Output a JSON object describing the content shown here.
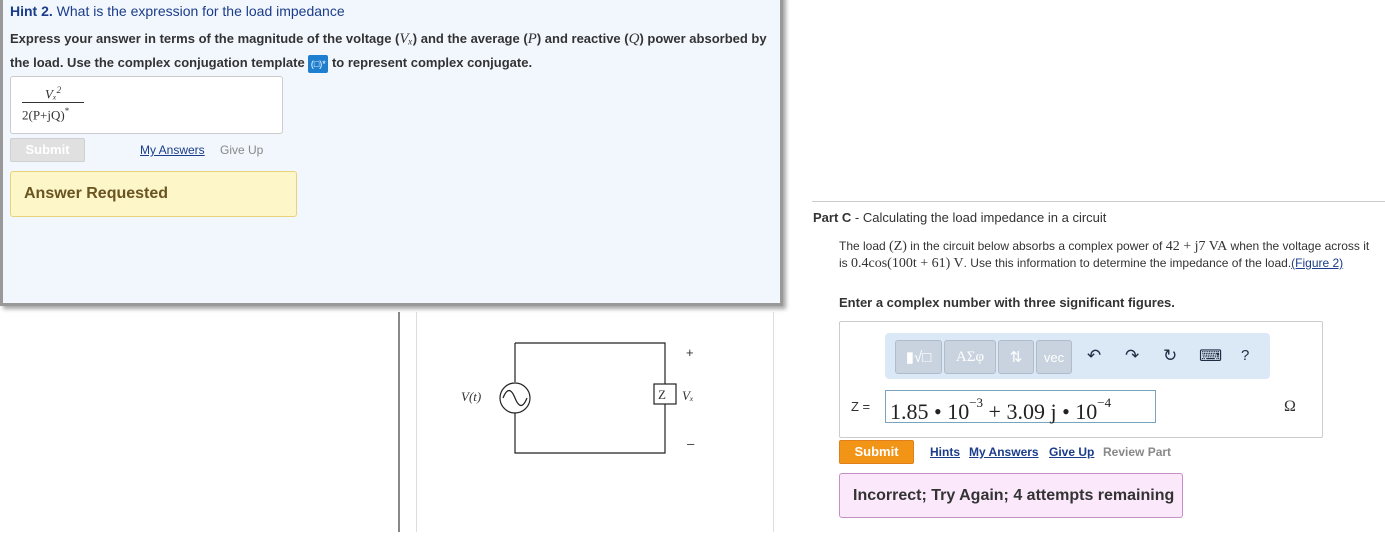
{
  "hint": {
    "number": "Hint 2.",
    "title": "What is the expression for the load impedance",
    "instr_1": "Express your answer in terms of the magnitude of the voltage (",
    "sym_vx": "Vₓ",
    "instr_2": ") and the average (",
    "sym_p": "P",
    "instr_3": ") and reactive (",
    "sym_q": "Q",
    "instr_4": ") power absorbed by the load. Use the complex conjugation template",
    "conj_icon": "(□)*",
    "instr_5": "to represent complex conjugate.",
    "answer_num": "Vₓ",
    "answer_num_exp": "2",
    "answer_den": "2(P+jQ)",
    "answer_den_exp": "*",
    "submit": "Submit",
    "my_answers": "My Answers",
    "give_up": "Give Up",
    "status": "Answer Requested"
  },
  "figure": {
    "source_label": "V(t)",
    "load_label": "Z",
    "voltage_label": "Vₓ",
    "plus": "+",
    "minus": "–"
  },
  "part_c": {
    "label": "Part C",
    "title": "Calculating the load impedance in a circuit",
    "desc_1": "The load ",
    "desc_z": "(Z)",
    "desc_2": " in the circuit below absorbs a complex power of ",
    "desc_power": "42 + j7 VA",
    "desc_3": " when the voltage across it is ",
    "desc_voltage": "0.4cos(100t + 61) V",
    "desc_4": ". Use this information to determine the impedance of the load.",
    "figure_link": "(Figure 2)",
    "instruction": "Enter a complex number with three significant figures.",
    "toolbar": {
      "templates": "▮√□",
      "greek": "ΑΣφ",
      "arrows": "⇅",
      "vec": "vec",
      "undo": "↶",
      "redo": "↷",
      "reset": "↻",
      "keyboard": "⌨",
      "help": "?"
    },
    "z_label": "Z =",
    "answer_a": "1.85 • 10",
    "answer_a_exp": "−3",
    "answer_b": "+ 3.09 j • 10",
    "answer_b_exp": "−4",
    "unit": "Ω",
    "submit": "Submit",
    "hints": "Hints",
    "my_answers": "My Answers",
    "give_up": "Give Up",
    "review_part": "Review Part",
    "feedback": "Incorrect; Try Again; 4 attempts remaining"
  }
}
